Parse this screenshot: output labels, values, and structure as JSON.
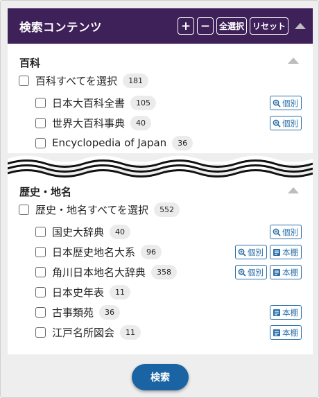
{
  "header": {
    "title": "検索コンテンツ",
    "plus_label": "+",
    "minus_label": "−",
    "select_all_label": "全選択",
    "reset_label": "リセット"
  },
  "sections": [
    {
      "title": "百科",
      "select_all": {
        "label": "百科すべてを選択",
        "count": "181"
      },
      "items": [
        {
          "label": "日本大百科全書",
          "count": "105",
          "buttons": [
            "個別"
          ]
        },
        {
          "label": "世界大百科事典",
          "count": "40",
          "buttons": [
            "個別"
          ]
        },
        {
          "label": "Encyclopedia of Japan",
          "count": "36",
          "buttons": []
        }
      ]
    },
    {
      "title": "歴史・地名",
      "select_all": {
        "label": "歴史・地名すべてを選択",
        "count": "552"
      },
      "items": [
        {
          "label": "国史大辞典",
          "count": "40",
          "buttons": [
            "個別"
          ]
        },
        {
          "label": "日本歴史地名大系",
          "count": "96",
          "buttons": [
            "個別",
            "本棚"
          ]
        },
        {
          "label": "角川日本地名大辞典",
          "count": "358",
          "buttons": [
            "個別",
            "本棚"
          ]
        },
        {
          "label": "日本史年表",
          "count": "11",
          "buttons": []
        },
        {
          "label": "古事類苑",
          "count": "36",
          "buttons": [
            "本棚"
          ]
        },
        {
          "label": "江戸名所図会",
          "count": "11",
          "buttons": [
            "本棚"
          ]
        }
      ]
    }
  ],
  "footer": {
    "search_label": "検索"
  },
  "colors": {
    "header_bg": "#3f2159",
    "accent_blue": "#2a6fa8",
    "search_button": "#1a64a3"
  },
  "icons": {
    "individual": "magnifier-icon",
    "bookshelf": "book-icon",
    "collapse": "triangle-up-icon"
  }
}
